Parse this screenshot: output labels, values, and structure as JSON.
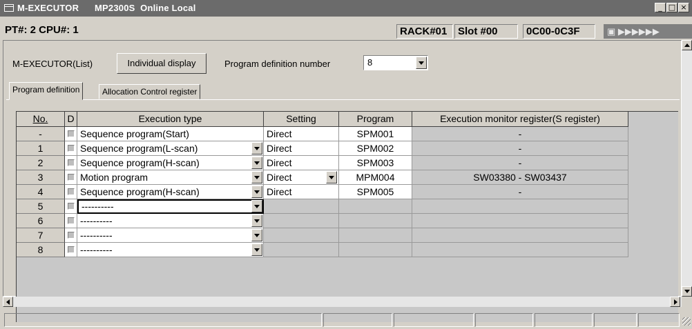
{
  "window": {
    "title": "M-EXECUTOR      MP2300S  Online Local",
    "minimize": "_",
    "maximize": "□",
    "close": "×"
  },
  "status": {
    "pt_cpu": "PT#: 2 CPU#: 1",
    "rack": "RACK#01",
    "slot": "Slot #00",
    "range": "0C00-0C3F",
    "online_indicator": "▶▶▶▶▶▶"
  },
  "toolbar": {
    "mode_label": "M-EXECUTOR(List)",
    "individual_display_button": "Individual display",
    "program_definition_number_label": "Program definition number",
    "program_definition_number_value": "8"
  },
  "tabs": [
    {
      "label": "Program definition",
      "active": true
    },
    {
      "label": "Allocation Control register",
      "active": false
    }
  ],
  "table": {
    "columns": [
      "No.",
      "D",
      "Execution type",
      "Setting",
      "Program",
      "Execution monitor register(S register)"
    ],
    "rows": [
      {
        "no": "-",
        "type": "Sequence program(Start)",
        "type_dropdown": false,
        "setting": "Direct",
        "setting_dropdown": false,
        "program": "SPM001",
        "monitor": "-"
      },
      {
        "no": "1",
        "type": "Sequence program(L-scan)",
        "type_dropdown": true,
        "setting": "Direct",
        "setting_dropdown": false,
        "program": "SPM002",
        "monitor": "-"
      },
      {
        "no": "2",
        "type": "Sequence program(H-scan)",
        "type_dropdown": true,
        "setting": "Direct",
        "setting_dropdown": false,
        "program": "SPM003",
        "monitor": "-"
      },
      {
        "no": "3",
        "type": "Motion program",
        "type_dropdown": true,
        "setting": "Direct",
        "setting_dropdown": true,
        "program": "MPM004",
        "monitor": "SW03380 - SW03437"
      },
      {
        "no": "4",
        "type": "Sequence program(H-scan)",
        "type_dropdown": true,
        "setting": "Direct",
        "setting_dropdown": false,
        "program": "SPM005",
        "monitor": "-"
      },
      {
        "no": "5",
        "type": "----------",
        "type_dropdown": true,
        "setting": "",
        "setting_dropdown": false,
        "program": "",
        "monitor": "",
        "selected": true
      },
      {
        "no": "6",
        "type": "----------",
        "type_dropdown": true,
        "setting": "",
        "setting_dropdown": false,
        "program": "",
        "monitor": ""
      },
      {
        "no": "7",
        "type": "----------",
        "type_dropdown": true,
        "setting": "",
        "setting_dropdown": false,
        "program": "",
        "monitor": ""
      },
      {
        "no": "8",
        "type": "----------",
        "type_dropdown": true,
        "setting": "",
        "setting_dropdown": false,
        "program": "",
        "monitor": ""
      }
    ]
  },
  "colors": {
    "titlebar": "#6b6b6b",
    "face": "#d4d0c8",
    "empty_cell": "#c8c8c8"
  }
}
